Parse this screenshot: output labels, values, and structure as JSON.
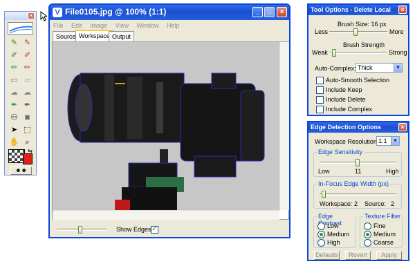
{
  "toolbox": {
    "tools": [
      "brush-keep-icon",
      "brush-delete-icon",
      "pen-keep-icon",
      "pen-delete-icon",
      "fill-keep-icon",
      "fill-delete-icon",
      "eraser-icon",
      "eraser-alt-icon",
      "smooth-icon",
      "smooth-alt-icon",
      "pencil-icon",
      "pencil-alt-icon",
      "bucket-icon",
      "camera-icon",
      "pointer-icon",
      "selection-icon",
      "hand-icon",
      "zoom-icon"
    ],
    "close_label": "×"
  },
  "main_window": {
    "title": "File0105.jpg @ 100% (1:1)",
    "menu": [
      "File",
      "Edit",
      "Image",
      "View",
      "Window",
      "Help"
    ],
    "tabs": [
      "Source",
      "Workspace",
      "Output"
    ],
    "active_tab": "Workspace",
    "show_edges_label": "Show Edges:",
    "show_edges_checked": true,
    "zoom_slider_value": 0.45
  },
  "tool_options": {
    "title": "Tool Options - Delete Local",
    "brush_size_label": "Brush Size: 16 px",
    "less_label": "Less",
    "more_label": "More",
    "brush_size_value": 0.45,
    "brush_strength_label": "Brush Strength",
    "weak_label": "Weak",
    "strong_label": "Strong",
    "brush_strength_value": 0.05,
    "auto_complex_label": "Auto-Complex:",
    "auto_complex_value": "Thick",
    "checkboxes": [
      {
        "label": "Auto-Smooth Selection",
        "checked": false
      },
      {
        "label": "Include Keep",
        "checked": false
      },
      {
        "label": "Include Delete",
        "checked": false
      },
      {
        "label": "Include Complex",
        "checked": false
      }
    ]
  },
  "edge_detection": {
    "title": "Edge Detection Options",
    "workspace_resolution_label": "Workspace Resolution:",
    "workspace_resolution_value": "1:1",
    "edge_sensitivity_label": "Edge Sensitivity",
    "low_label": "Low",
    "high_label": "High",
    "sensitivity_value": "11",
    "sensitivity_fraction": 0.5,
    "in_focus_label": "In-Focus Edge Width (px)",
    "in_focus_fraction": 0.05,
    "workspace_label": "Workspace:",
    "workspace_value": "2",
    "source_label": "Source:",
    "source_value": "2",
    "edge_contrast_label": "Edge Contrast",
    "edge_contrast_options": [
      "Low",
      "Medium",
      "High"
    ],
    "edge_contrast_selected": "Medium",
    "texture_filter_label": "Texture Filter",
    "texture_filter_options": [
      "Fine",
      "Medium",
      "Coarse"
    ],
    "texture_filter_selected": "Medium",
    "buttons": [
      "Defaults",
      "Revert",
      "Apply"
    ]
  }
}
